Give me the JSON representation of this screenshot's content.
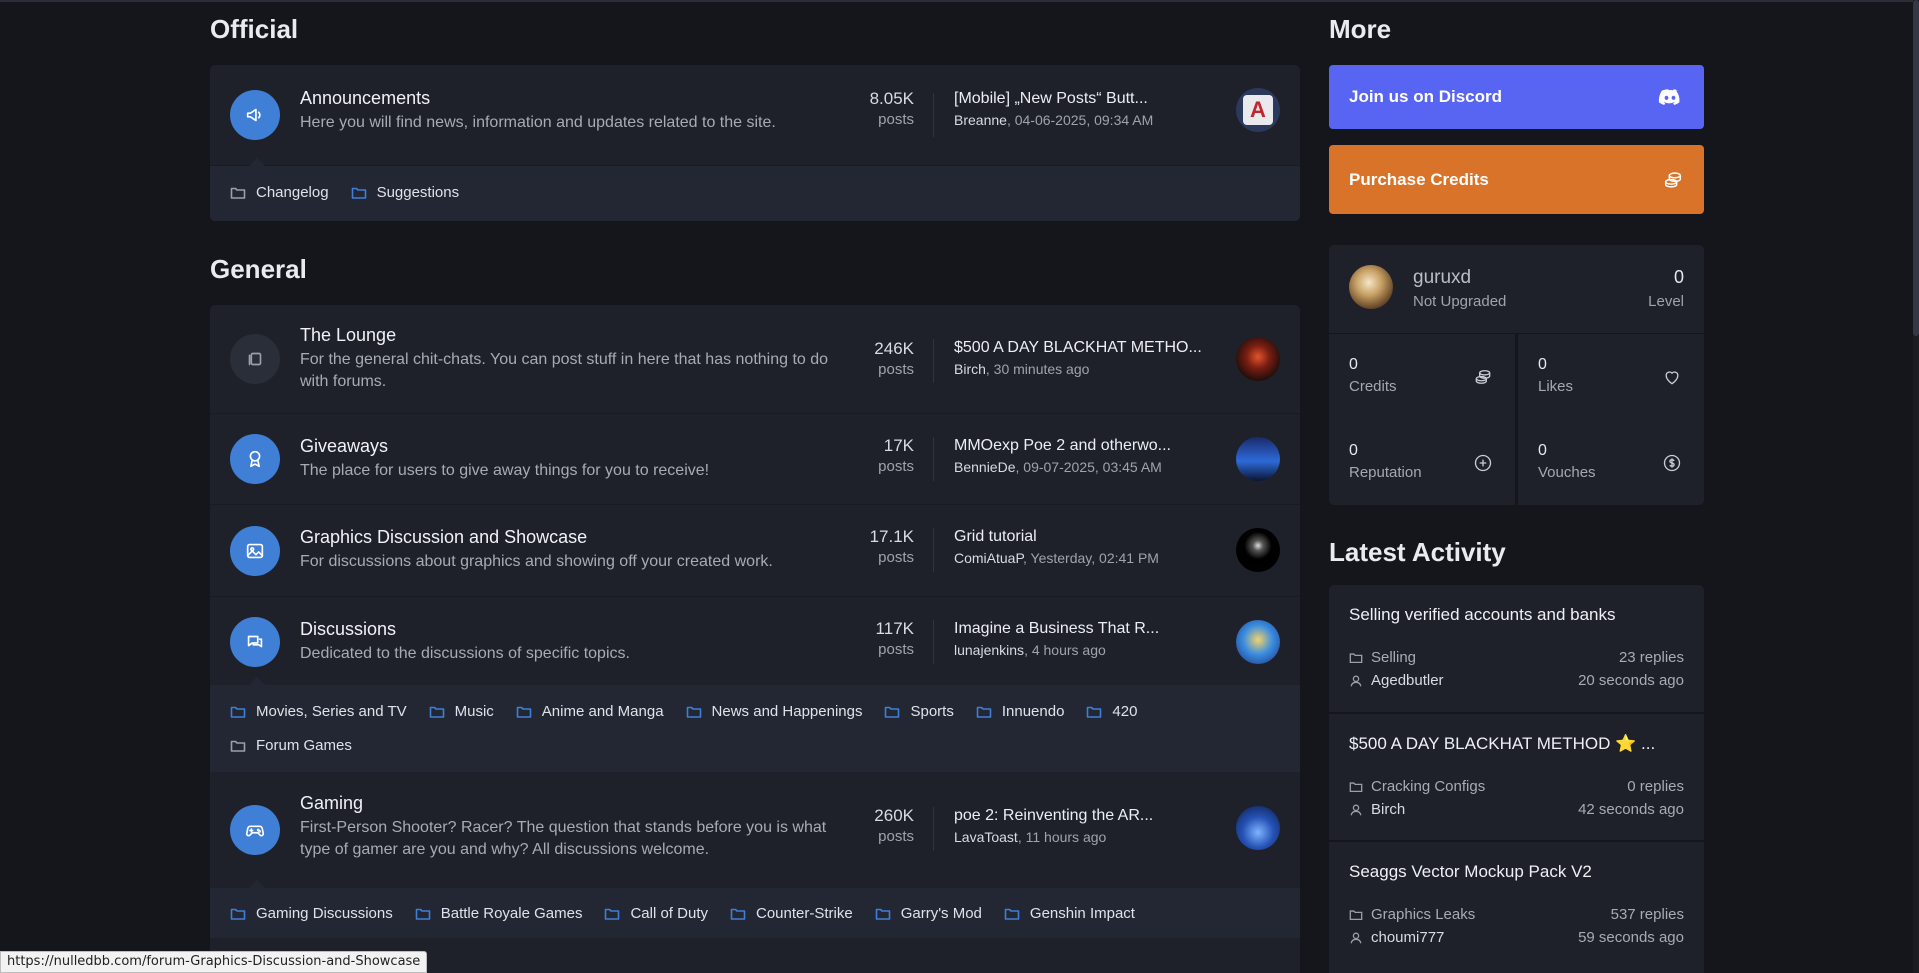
{
  "official": {
    "title": "Official",
    "forum": {
      "title": "Announcements",
      "desc": "Here you will find news, information and updates related to the site.",
      "count": "8.05K",
      "count_label": "posts",
      "last_title": "[Mobile] „New Posts“ Butt...",
      "last_user": "Breanne",
      "last_time": ", 04-06-2025, 09:34 AM",
      "avatar_letter": "A"
    },
    "subforums": [
      "Changelog",
      "Suggestions"
    ]
  },
  "general": {
    "title": "General",
    "forums": [
      {
        "title": "The Lounge",
        "desc": "For the general chit-chats. You can post stuff in here that has nothing to do with forums.",
        "count": "246K",
        "count_label": "posts",
        "last_title": "$500 A DAY BLACKHAT METHO...",
        "last_user": "Birch",
        "last_time": ", 30 minutes ago",
        "icon": "copy-icon"
      },
      {
        "title": "Giveaways",
        "desc": "The place for users to give away things for you to receive!",
        "count": "17K",
        "count_label": "posts",
        "last_title": "MMOexp Poe 2 and otherwo...",
        "last_user": "BennieDe",
        "last_time": ", 09-07-2025, 03:45 AM",
        "icon": "award-icon"
      },
      {
        "title": "Graphics Discussion and Showcase",
        "desc": "For discussions about graphics and showing off your created work.",
        "count": "17.1K",
        "count_label": "posts",
        "last_title": "Grid tutorial",
        "last_user": "ComiAtuaP",
        "last_time": ", Yesterday, 02:41 PM",
        "icon": "image-icon"
      },
      {
        "title": "Discussions",
        "desc": "Dedicated to the discussions of specific topics.",
        "count": "117K",
        "count_label": "posts",
        "last_title": "Imagine a Business That R...",
        "last_user": "lunajenkins",
        "last_time": ", 4 hours ago",
        "icon": "chat-icon"
      }
    ],
    "discussion_subforums": [
      "Movies, Series and TV",
      "Music",
      "Anime and Manga",
      "News and Happenings",
      "Sports",
      "Innuendo",
      "420",
      "Forum Games"
    ],
    "gaming": {
      "title": "Gaming",
      "desc": "First-Person Shooter? Racer? The question that stands before you is what type of gamer are you and why? All discussions welcome.",
      "count": "260K",
      "count_label": "posts",
      "last_title": "poe 2: Reinventing the AR...",
      "last_user": "LavaToast",
      "last_time": ", 11 hours ago",
      "icon": "gamepad-icon"
    },
    "gaming_subforums": [
      "Gaming Discussions",
      "Battle Royale Games",
      "Call of Duty",
      "Counter-Strike",
      "Garry's Mod",
      "Genshin Impact"
    ]
  },
  "more": {
    "title": "More",
    "discord_label": "Join us on Discord",
    "credits_label": "Purchase Credits",
    "discord_color": "#5865f2",
    "credits_color": "#d9732a"
  },
  "user": {
    "name": "guruxd",
    "group": "Not Upgraded",
    "level": "0",
    "level_label": "Level",
    "stats": [
      {
        "value": "0",
        "label": "Credits",
        "icon": "credits-icon"
      },
      {
        "value": "0",
        "label": "Likes",
        "icon": "heart-icon"
      },
      {
        "value": "0",
        "label": "Reputation",
        "icon": "plus-circle-icon"
      },
      {
        "value": "0",
        "label": "Vouches",
        "icon": "dollar-circle-icon"
      }
    ]
  },
  "activity": {
    "title": "Latest Activity",
    "items": [
      {
        "title": "Selling verified accounts and banks",
        "forum": "Selling",
        "user": "Agedbutler",
        "replies": "23 replies",
        "time": "20 seconds ago"
      },
      {
        "title": "$500 A DAY BLACKHAT METHOD ⭐ ...",
        "forum": "Cracking Configs",
        "user": "Birch",
        "replies": "0 replies",
        "time": "42 seconds ago"
      },
      {
        "title": "Seaggs Vector Mockup Pack V2",
        "forum": "Graphics Leaks",
        "user": "choumi777",
        "replies": "537 replies",
        "time": "59 seconds ago"
      }
    ]
  },
  "statusbar": {
    "url": "https://nulledbb.com/forum-Graphics-Discussion-and-Showcase"
  }
}
